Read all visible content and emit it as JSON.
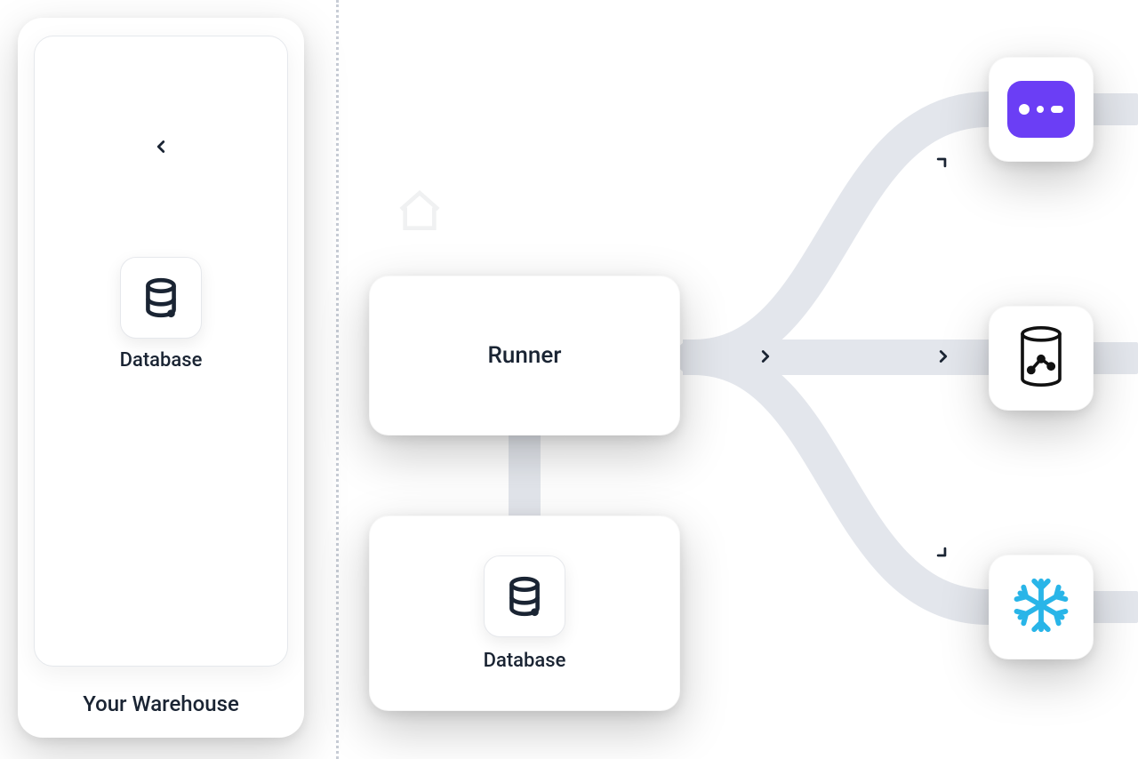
{
  "warehouse": {
    "title": "Your Warehouse",
    "source": {
      "label": "Database",
      "icon": "database-icon"
    }
  },
  "center": {
    "runner": {
      "label": "Runner"
    },
    "database": {
      "label": "Database",
      "icon": "database-icon"
    }
  },
  "destinations": [
    {
      "id": "app-generic",
      "icon": "more-icon",
      "accent": "#6b3ef5"
    },
    {
      "id": "analytics-db",
      "icon": "cylinder-graph-icon"
    },
    {
      "id": "snowflake",
      "icon": "snowflake-icon",
      "accent": "#29b5e8"
    }
  ],
  "colors": {
    "text": "#1a2433",
    "connector": "#e3e6ec",
    "accent_purple": "#6b3ef5",
    "accent_snowflake": "#29b5e8"
  }
}
